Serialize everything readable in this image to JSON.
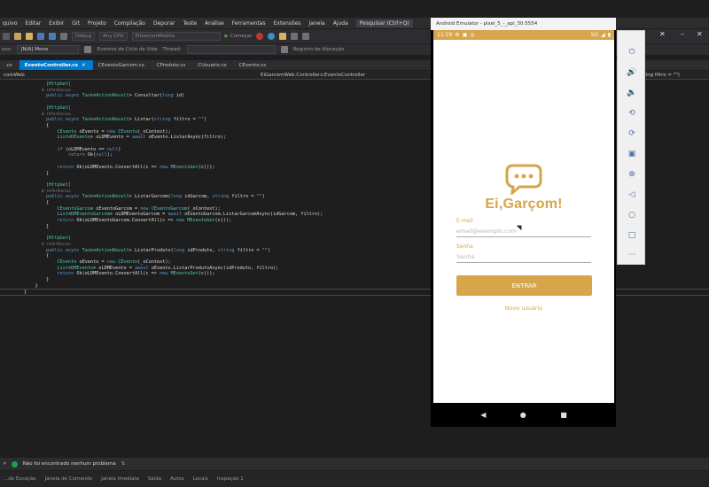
{
  "vs": {
    "menu": [
      "quivo",
      "Editar",
      "Exibir",
      "Git",
      "Projeto",
      "Compilação",
      "Depurar",
      "Teste",
      "Análise",
      "Ferramentas",
      "Extensões",
      "Janela",
      "Ajuda"
    ],
    "search_label": "Pesquisar (Ctrl+Q)",
    "toolbar": {
      "config": "Debug",
      "platform": "Any CPU",
      "project": "EiGarcomMobile",
      "run_label": "Começar"
    },
    "toolbar2": {
      "mode": "[N/A] Mono",
      "lifecycle": "Eventos de Ciclo de Vida",
      "thread": "Thread:",
      "stack": "Registro de Alocação"
    },
    "left_context": "comWeb",
    "tabs": [
      {
        "label": "EventoController.cs",
        "active": true
      },
      {
        "label": "CEventoGarcom.cs",
        "active": false
      },
      {
        "label": "CProduto.cs",
        "active": false
      },
      {
        "label": "CUsuario.cs",
        "active": false
      },
      {
        "label": "CEvento.cs",
        "active": false
      }
    ],
    "nav_class": "EiGarcomWeb.Controllers.EventoController",
    "nav_member": "Listar(string filtro = \"\")",
    "status_message": "Não foi encontrado nenhum problema",
    "bottom_tabs": [
      "...de Exceção",
      "Janela de Comando",
      "Janela Imediata",
      "Saída",
      "Autos",
      "Locais",
      "Inspeção 1"
    ]
  },
  "code_lines": [
    {
      "n": "",
      "t": "        [HttpGet]",
      "refs": false
    },
    {
      "n": "",
      "t": "        0 referências",
      "refs": true
    },
    {
      "n": "",
      "t": "        public async Task<ActionResult> Consultar(long id)",
      "refs": false
    },
    {
      "n": "",
      "t": "",
      "refs": false
    },
    {
      "n": "",
      "t": "        [HttpGet]",
      "refs": false
    },
    {
      "n": "",
      "t": "        0 referências",
      "refs": true
    },
    {
      "n": "",
      "t": "        public async Task<ActionResult> Listar(string filtro = \"\")",
      "refs": false
    },
    {
      "n": "",
      "t": "        {",
      "refs": false
    },
    {
      "n": "",
      "t": "            CEvento oEvento = new CEvento(_oContext);",
      "refs": false
    },
    {
      "n": "",
      "t": "            List<DEvento> oLDMEvento = await oEvento.ListarAsync(filtro);",
      "refs": false
    },
    {
      "n": "",
      "t": "",
      "refs": false
    },
    {
      "n": "",
      "t": "            if (oLDMEvento == null)",
      "refs": false
    },
    {
      "n": "",
      "t": "                return Ok(null);",
      "refs": false
    },
    {
      "n": "",
      "t": "",
      "refs": false
    },
    {
      "n": "",
      "t": "            return Ok(oLDMEvento.ConvertAll(c => new MEventoGet(c)));",
      "refs": false
    },
    {
      "n": "",
      "t": "        }",
      "refs": false
    },
    {
      "n": "",
      "t": "",
      "refs": false
    },
    {
      "n": "",
      "t": "        [HttpGet]",
      "refs": false
    },
    {
      "n": "",
      "t": "        0 referências",
      "refs": true
    },
    {
      "n": "",
      "t": "        public async Task<ActionResult> ListarGarcom(long idGarcom, string filtro = \"\")",
      "refs": false
    },
    {
      "n": "",
      "t": "        {",
      "refs": false
    },
    {
      "n": "",
      "t": "            CEventoGarcom oEventoGarcom = new CEventoGarcom(_oContext);",
      "refs": false
    },
    {
      "n": "",
      "t": "            List<DMEventoGarcom> oLDMEventoGarcom = await oEventoGarcom.ListarGarcomAsync(idGarcom, filtro);",
      "refs": false
    },
    {
      "n": "",
      "t": "            return Ok(oLDMEventoGarcom.ConvertAll(c => new MEventoGet(c)));",
      "refs": false
    },
    {
      "n": "",
      "t": "        }",
      "refs": false
    },
    {
      "n": "",
      "t": "",
      "refs": false
    },
    {
      "n": "",
      "t": "        [HttpGet]",
      "refs": false
    },
    {
      "n": "",
      "t": "        0 referências",
      "refs": true
    },
    {
      "n": "",
      "t": "        public async Task<ActionResult> ListarProduto(long idProduto, string filtro = \"\")",
      "refs": false
    },
    {
      "n": "",
      "t": "        {",
      "refs": false
    },
    {
      "n": "",
      "t": "            CEvento oEvento = new CEvento(_oContext);",
      "refs": false
    },
    {
      "n": "",
      "t": "            List<DMEvento> oLDMEvento = await oEvento.ListarProdutoAsync(idProduto, filtro);",
      "refs": false
    },
    {
      "n": "",
      "t": "            return Ok(oLDMEvento.ConvertAll(c => new MEventoGet(c)));",
      "refs": false
    },
    {
      "n": "",
      "t": "        }",
      "refs": false
    },
    {
      "n": "",
      "t": "    }",
      "refs": false
    },
    {
      "n": "",
      "t": "}",
      "refs": false
    }
  ],
  "emulator": {
    "title": "Android Emulator - pixel_5_-_api_30:5554",
    "status_time": "11:59",
    "status_signal": "5G",
    "app_name": "Ei,Garçom!",
    "email_label": "E-mail",
    "email_placeholder": "email@exemplo.com",
    "password_label": "Senha",
    "password_placeholder": "Senha",
    "login_button": "ENTRAR",
    "new_user_link": "Novo usuário"
  },
  "colors": {
    "brand": "#d7a54a",
    "vs_accent": "#007acc"
  }
}
